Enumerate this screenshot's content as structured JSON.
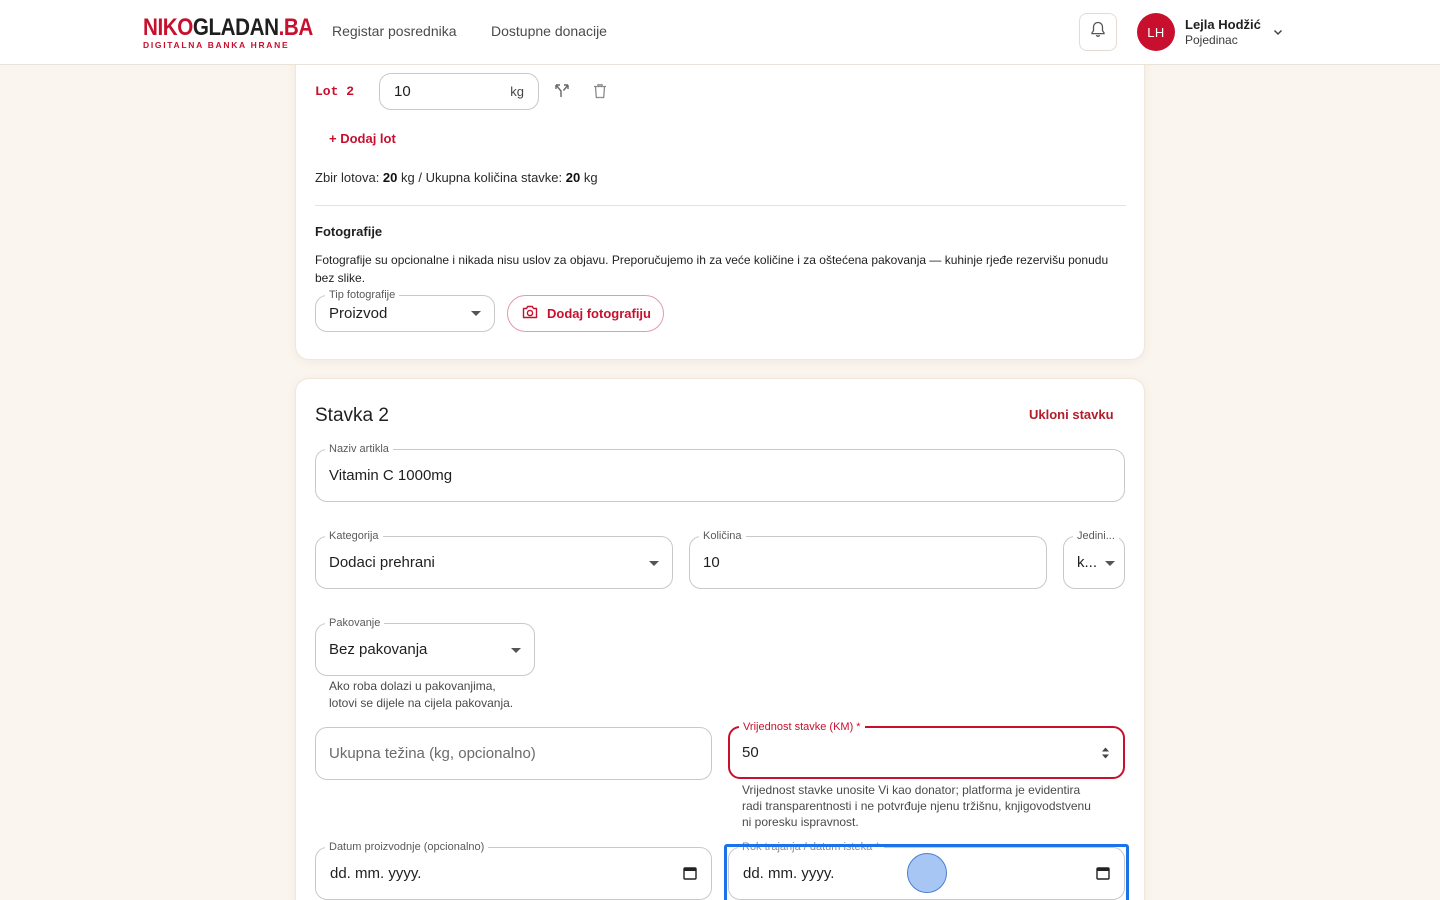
{
  "header": {
    "logo_main_a": "NIKO",
    "logo_main_b": "GLADAN",
    "logo_main_c": ".BA",
    "logo_sub": "DIGITALNA BANKA HRANE",
    "nav": [
      "Registar posrednika",
      "Dostupne donacije"
    ],
    "user": {
      "initials": "LH",
      "name": "Lejla Hodžić",
      "role": "Pojedinac"
    }
  },
  "item1": {
    "lot": {
      "label": "Lot 2",
      "value": "10",
      "unit": "kg"
    },
    "add_lot": "+ Dodaj lot",
    "summary": {
      "prefix": "Zbir lotova: ",
      "lots_total": "20",
      "mid": " kg / Ukupna količina stavke: ",
      "item_total": "20",
      "suffix": " kg"
    },
    "photos": {
      "title": "Fotografije",
      "note": "Fotografije su opcionalne i nikada nisu uslov za objavu. Preporučujemo ih za veće količine i za oštećena pakovanja — kuhinje rjeđe rezervišu ponudu bez slike.",
      "type_label": "Tip fotografije",
      "type_value": "Proizvod",
      "add_button": "Dodaj fotografiju"
    }
  },
  "item2": {
    "title": "Stavka 2",
    "remove": "Ukloni stavku",
    "name": {
      "label": "Naziv artikla",
      "value": "Vitamin C 1000mg"
    },
    "category": {
      "label": "Kategorija",
      "value": "Dodaci prehrani"
    },
    "quantity": {
      "label": "Količina",
      "value": "10"
    },
    "unit": {
      "label": "Jedini...",
      "value": "k..."
    },
    "packaging": {
      "label": "Pakovanje",
      "value": "Bez pakovanja",
      "helper_1": "Ako roba dolazi u pakovanjima,",
      "helper_2": "lotovi se dijele na cijela pakovanja."
    },
    "weight": {
      "placeholder": "Ukupna težina (kg, opcionalno)"
    },
    "value": {
      "label": "Vrijednost stavke (KM) *",
      "value": "50",
      "helper_1": "Vrijednost stavke unosite Vi kao donator; platforma je evidentira",
      "helper_2": "radi transparentnosti i ne potvrđuje njenu tržišnu, knjigovodstvenu",
      "helper_3": "ni poresku ispravnost."
    },
    "production_date": {
      "label": "Datum proizvodnje (opcionalno)",
      "value": "dd. mm. yyyy."
    },
    "expiry_date": {
      "label": "Rok trajanja / datum isteka *",
      "value": "dd. mm. yyyy."
    }
  },
  "colors": {
    "brand": "#c8102e",
    "focus": "#1a73e8"
  }
}
